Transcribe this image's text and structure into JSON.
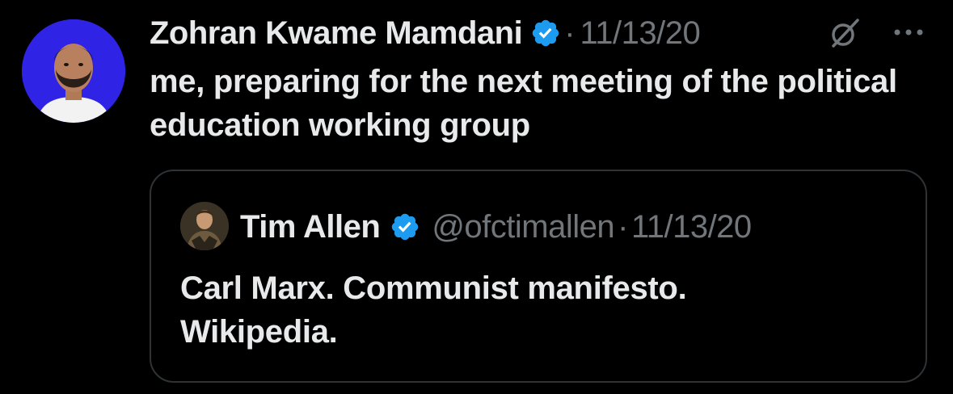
{
  "tweet": {
    "author_name": "Zohran Kwame Mamdani",
    "separator": "·",
    "date": "11/13/20",
    "text": "me, preparing for the next meeting of the political education working group",
    "verified_icon": "verified-badge-icon",
    "grok_icon": "grok-icon",
    "more_icon": "more-options-icon"
  },
  "quoted_tweet": {
    "author_name": "Tim Allen",
    "handle": "@ofctimallen",
    "separator": "·",
    "date": "11/13/20",
    "text_line_1": "Carl Marx. Communist manifesto.",
    "text_line_2": "Wikipedia.",
    "verified_icon": "verified-badge-icon"
  },
  "colors": {
    "background": "#000000",
    "primary_text": "#e7e9ea",
    "secondary_text": "#71767b",
    "verified_blue": "#1d9bf0",
    "avatar_bg": "#2f24e6",
    "border": "#2f3336"
  }
}
